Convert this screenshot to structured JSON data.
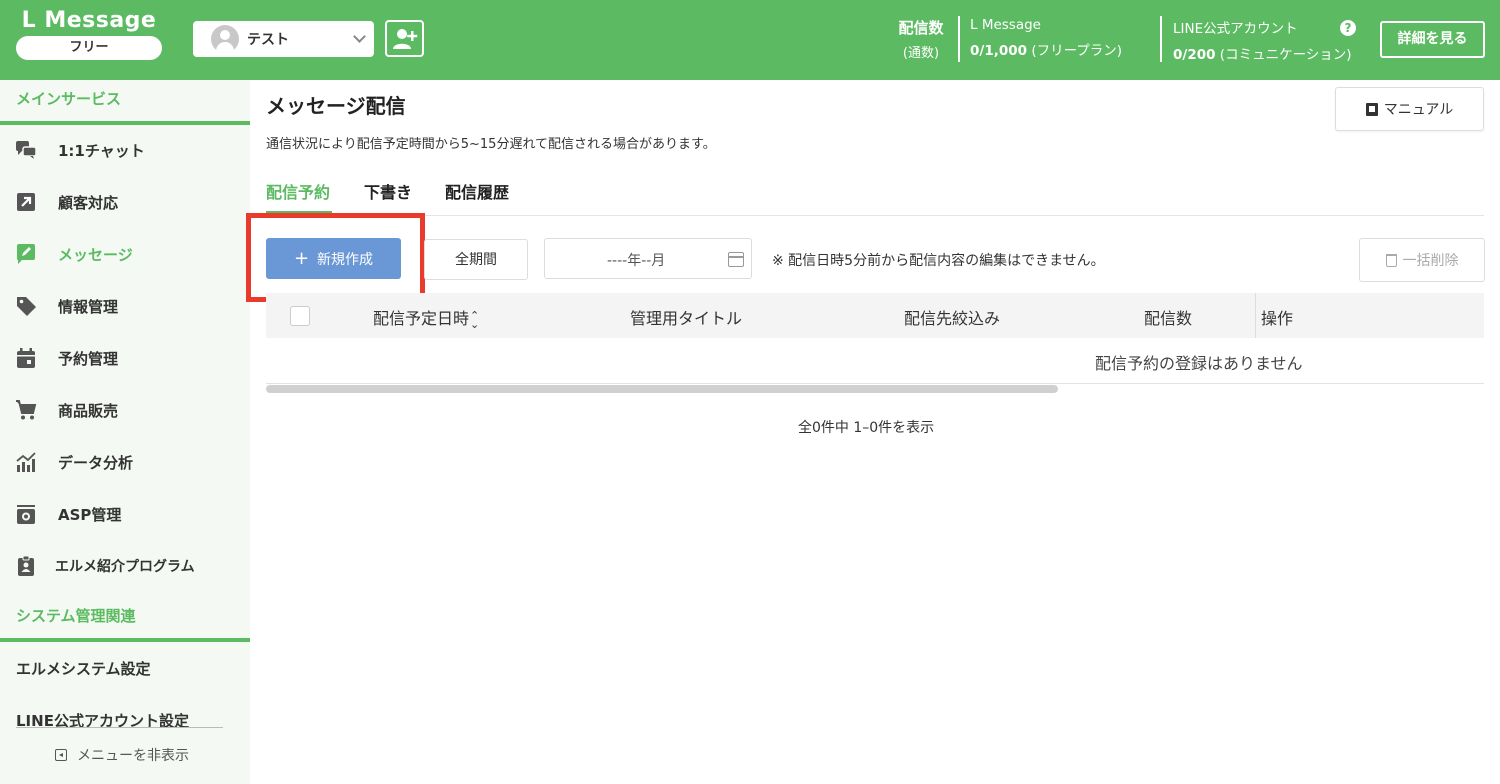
{
  "header": {
    "logo_title": "L Message",
    "plan": "フリー",
    "account_name": "テスト",
    "delivery_count_label": "配信数",
    "delivery_count_unit": "(通数)",
    "lmessage_title": "L Message",
    "lmessage_value": "0/1,000",
    "lmessage_plan": " (フリープラン)",
    "line_title": "LINE公式アカウント",
    "line_value": "0/200",
    "line_plan": " (コミュニケーション)",
    "help_icon": "?",
    "details_button": "詳細を見る"
  },
  "sidebar": {
    "main_section_title": "メインサービス",
    "items": [
      {
        "label": "1:1チャット",
        "icon": "chat-icon"
      },
      {
        "label": "顧客対応",
        "icon": "arrow-icon"
      },
      {
        "label": "メッセージ",
        "icon": "edit-icon"
      },
      {
        "label": "情報管理",
        "icon": "tag-icon"
      },
      {
        "label": "予約管理",
        "icon": "calendar-icon"
      },
      {
        "label": "商品販売",
        "icon": "cart-icon"
      },
      {
        "label": "データ分析",
        "icon": "chart-icon"
      },
      {
        "label": "ASP管理",
        "icon": "asp-icon"
      },
      {
        "label": "エルメ紹介プログラム",
        "icon": "badge-icon"
      }
    ],
    "system_section_title": "システム管理関連",
    "system_items": [
      "エルメシステム設定",
      "LINE公式アカウント設定"
    ],
    "hide_menu": "メニューを非表示"
  },
  "main": {
    "title": "メッセージ配信",
    "manual_button": "マニュアル",
    "notice": "通信状況により配信予定時間から5~15分遅れて配信される場合があります。",
    "tabs": [
      "配信予約",
      "下書き",
      "配信履歴"
    ],
    "new_button": "新規作成",
    "period_button": "全期間",
    "date_placeholder": "----年--月",
    "edit_note": "※ 配信日時5分前から配信内容の編集はできません。",
    "bulk_delete": "一括削除",
    "table": {
      "columns": [
        "配信予定日時",
        "管理用タイトル",
        "配信先絞込み",
        "配信数",
        "操作"
      ],
      "empty_message": "配信予約の登録はありません"
    },
    "pagination": "全0件中 1–0件を表示"
  },
  "colors": {
    "brand_green": "#5cbb62",
    "primary_blue": "#6a98d6",
    "highlight_red": "#ea3a2b"
  }
}
